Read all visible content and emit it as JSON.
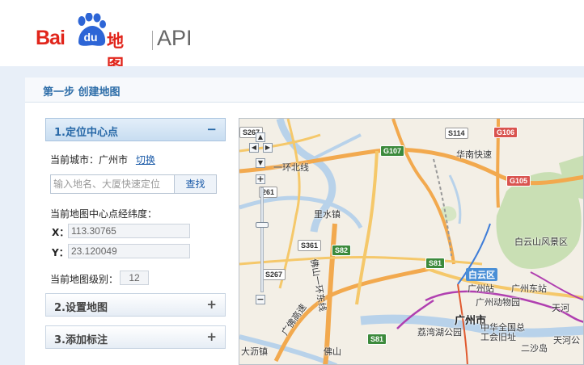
{
  "header": {
    "logo_bai": "Bai",
    "logo_du": "du",
    "logo_ditu": "地图",
    "logo_api": "API"
  },
  "step": {
    "title": "第一步  创建地图"
  },
  "panel": {
    "section1": {
      "label": "1.定位中心点",
      "sign": "−"
    },
    "current_city_label": "当前城市：",
    "current_city": "广州市",
    "switch_link": "切换",
    "search": {
      "placeholder": "输入地名、大厦快速定位",
      "button": "查找"
    },
    "center_label": "当前地图中心点经纬度：",
    "x_label": "X：",
    "x_value": "113.30765",
    "y_label": "Y：",
    "y_value": "23.120049",
    "zoom_label": "当前地图级别：",
    "zoom_value": "12",
    "section2": {
      "label": "2.设置地图",
      "sign": "+"
    },
    "section3": {
      "label": "3.添加标注",
      "sign": "+"
    }
  },
  "map": {
    "labels": {
      "huanbei": "一环北线",
      "lishui": "里水镇",
      "huanan": "华南快速",
      "baiyunshan": "白云山风景区",
      "baiyun": "白云区",
      "gz_station": "广州站",
      "gz_east": "广州东站",
      "zoo": "广州动物园",
      "gz_city": "广州市",
      "liwan_park": "荔湾湖公园",
      "zhonghua": "中华全国总工会旧址",
      "ershatou": "二沙岛",
      "tianhe": "天河",
      "tianhe_park": "天河公",
      "dali": "大沥镇",
      "foshan": "佛山一环东线",
      "guangfo": "广佛高速",
      "foshan2": "佛山"
    },
    "shields": {
      "s267a": "S267",
      "s114": "S114",
      "g106": "G106",
      "g107": "G107",
      "g105": "G105",
      "s261": "261",
      "s361": "S361",
      "s82": "S82",
      "s81a": "S81",
      "s267b": "S267",
      "s81b": "S81"
    },
    "nav": {
      "up": "▲",
      "down": "▼",
      "left": "◀",
      "right": "▶",
      "zoom_in": "+",
      "zoom_out": "−"
    }
  }
}
